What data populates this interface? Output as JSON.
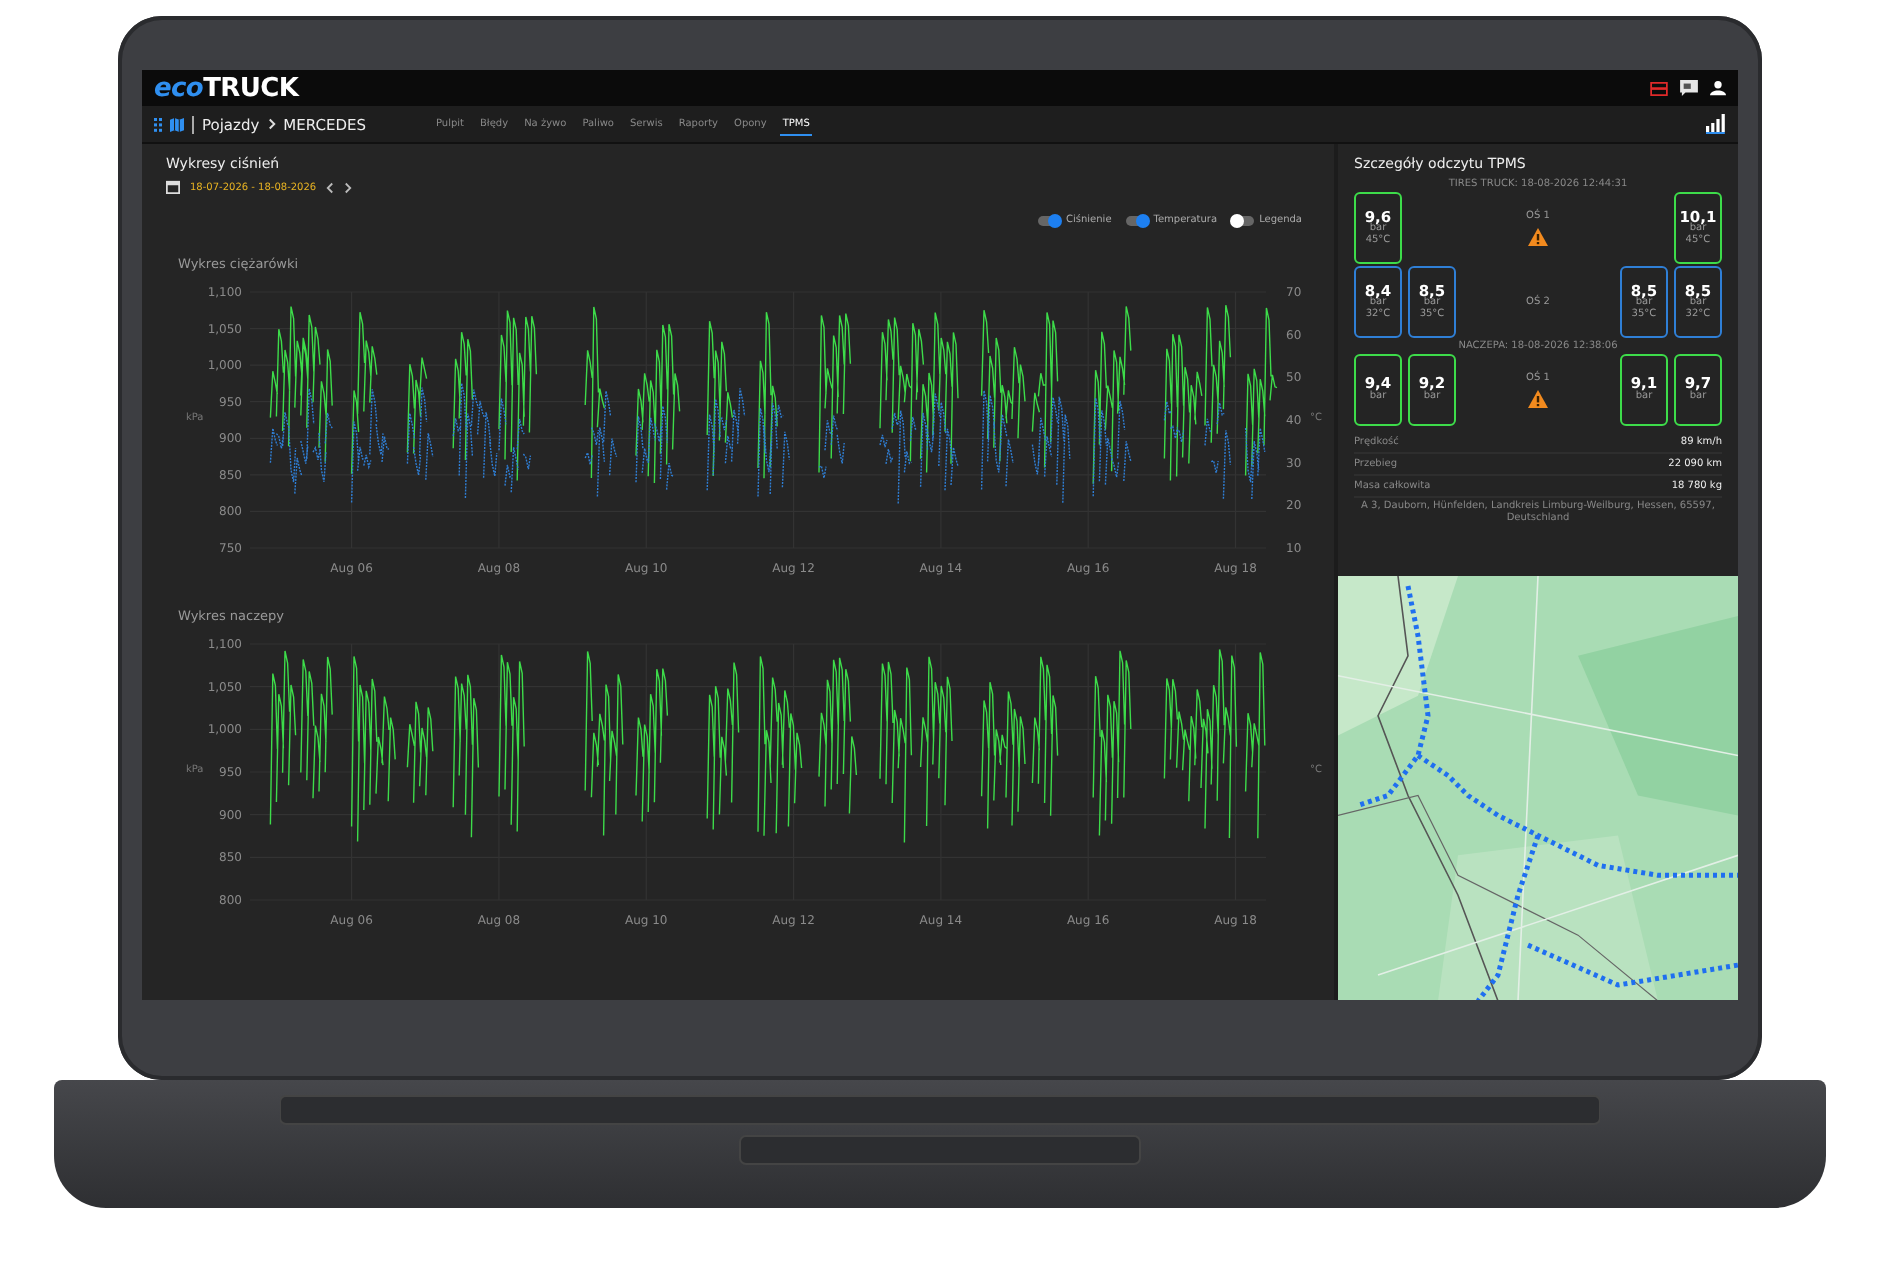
{
  "header": {
    "logo_prefix": "eco",
    "logo_name": "TRUCK"
  },
  "breadcrumb": [
    "Pojazdy",
    "MERCEDES"
  ],
  "tabs": [
    {
      "label": "Pulpit",
      "selected": false
    },
    {
      "label": "Błędy",
      "selected": false
    },
    {
      "label": "Na żywo",
      "selected": false
    },
    {
      "label": "Paliwo",
      "selected": false
    },
    {
      "label": "Serwis",
      "selected": false
    },
    {
      "label": "Raporty",
      "selected": false
    },
    {
      "label": "Opony",
      "selected": false
    },
    {
      "label": "TPMS",
      "selected": true
    }
  ],
  "pressure_panel": {
    "title": "Wykresy ciśnień",
    "date_range": "18-07-2026 - 18-08-2026",
    "toggles": [
      {
        "label": "Ciśnienie",
        "on": true
      },
      {
        "label": "Temperatura",
        "on": true
      },
      {
        "label": "Legenda",
        "on": false
      }
    ]
  },
  "charts": [
    {
      "title": "Wykres ciężarówki",
      "temperature_trace": true,
      "y_label": "kPa",
      "y2_label": "°C",
      "y_ticks": [
        "1,100",
        "1,050",
        "1,000",
        "950",
        "900",
        "850",
        "800",
        "750"
      ],
      "y2_ticks": [
        "70",
        "60",
        "50",
        "40",
        "30",
        "20",
        "10"
      ],
      "x_ticks": [
        "Aug 06",
        "Aug 08",
        "Aug 10",
        "Aug 12",
        "Aug 14",
        "Aug 16",
        "Aug 18"
      ]
    },
    {
      "title": "Wykres naczepy",
      "temperature_trace": false,
      "y_label": "kPa",
      "y2_label": "°C",
      "y_ticks": [
        "1,100",
        "1,050",
        "1,000",
        "950",
        "900",
        "850",
        "800"
      ],
      "x_ticks": [
        "Aug 06",
        "Aug 08",
        "Aug 10",
        "Aug 12",
        "Aug 14",
        "Aug 16",
        "Aug 18"
      ]
    }
  ],
  "tpms": {
    "title": "Szczegóły odczytu TPMS",
    "sections": [
      {
        "heading": "TIRES TRUCK: 18-08-2026 12:44:31",
        "axles": [
          {
            "label": "OŚ 1",
            "warning": true,
            "left": [
              {
                "value": "9,6",
                "unit": "bar",
                "temp": "45°C",
                "color": "#3ddc4a"
              }
            ],
            "right": [
              {
                "value": "10,1",
                "unit": "bar",
                "temp": "45°C",
                "color": "#3ddc4a"
              }
            ]
          },
          {
            "label": "OŚ 2",
            "warning": false,
            "left": [
              {
                "value": "8,4",
                "unit": "bar",
                "temp": "32°C",
                "color": "#2f7fd6"
              },
              {
                "value": "8,5",
                "unit": "bar",
                "temp": "35°C",
                "color": "#2f7fd6"
              }
            ],
            "right": [
              {
                "value": "8,5",
                "unit": "bar",
                "temp": "35°C",
                "color": "#2f7fd6"
              },
              {
                "value": "8,5",
                "unit": "bar",
                "temp": "32°C",
                "color": "#2f7fd6"
              }
            ]
          }
        ]
      },
      {
        "heading": "NACZEPA: 18-08-2026 12:38:06",
        "axles": [
          {
            "label": "OŚ 1",
            "warning": true,
            "left": [
              {
                "value": "9,4",
                "unit": "bar",
                "color": "#3ddc4a"
              },
              {
                "value": "9,2",
                "unit": "bar",
                "color": "#3ddc4a"
              }
            ],
            "right": [
              {
                "value": "9,1",
                "unit": "bar",
                "color": "#3ddc4a"
              },
              {
                "value": "9,7",
                "unit": "bar",
                "color": "#3ddc4a"
              }
            ]
          }
        ]
      }
    ],
    "stats": [
      {
        "label": "Prędkość",
        "value": "89 km/h"
      },
      {
        "label": "Przebieg",
        "value": "22 090 km"
      },
      {
        "label": "Masa całkowita",
        "value": "18 780 kg"
      }
    ],
    "address": "A 3, Dauborn, Hünfelden, Landkreis Limburg-Weilburg, Hessen, 65597, Deutschland"
  },
  "map": {
    "kind": "picture"
  }
}
